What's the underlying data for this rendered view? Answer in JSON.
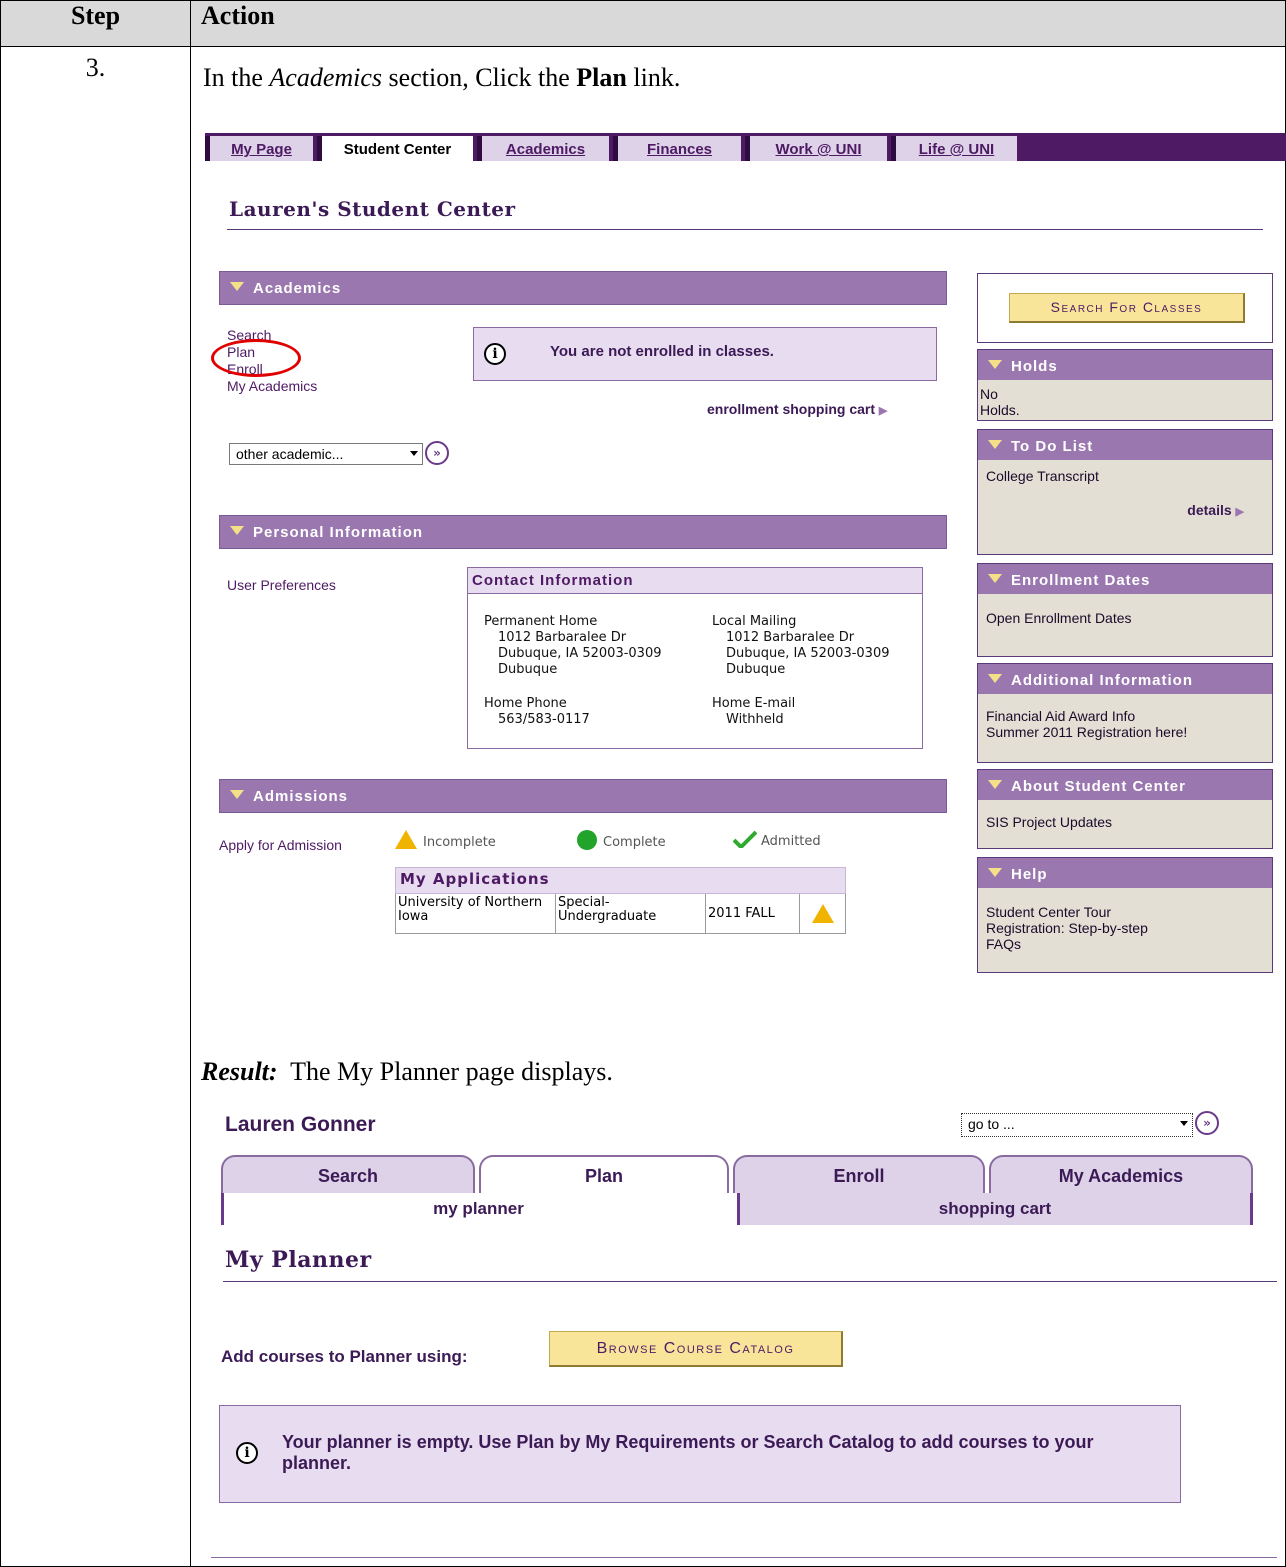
{
  "table": {
    "header_step": "Step",
    "header_action": "Action",
    "step_number": "3."
  },
  "instruction": {
    "prefix": "In the ",
    "section": "Academics",
    "middle": " section, Click the ",
    "link": "Plan",
    "suffix": " link."
  },
  "result": {
    "label": "Result:",
    "text": "  The My Planner page displays."
  },
  "student_center": {
    "tabs": [
      "My Page",
      "Student Center",
      "Academics",
      "Finances",
      "Work @ UNI",
      "Life @ UNI"
    ],
    "title": "Lauren's Student Center",
    "academics": {
      "heading": "Academics",
      "links": [
        "Search",
        "Plan",
        "Enroll",
        "My Academics"
      ],
      "notice": "You are not enrolled in classes.",
      "cart_link": "enrollment shopping cart",
      "dropdown_value": "other academic..."
    },
    "personal": {
      "heading": "Personal Information",
      "user_prefs": "User Preferences",
      "contact_heading": "Contact Information",
      "perm_label": "Permanent Home",
      "perm_line1": "1012 Barbaralee Dr",
      "perm_line2": "Dubuque, IA 52003-0309",
      "perm_line3": "Dubuque",
      "local_label": "Local Mailing",
      "local_line1": "1012 Barbaralee Dr",
      "local_line2": "Dubuque, IA 52003-0309",
      "local_line3": "Dubuque",
      "phone_label": "Home Phone",
      "phone_value": "563/583-0117",
      "email_label": "Home E-mail",
      "email_value": "Withheld"
    },
    "admissions": {
      "heading": "Admissions",
      "apply_link": "Apply for Admission",
      "legend_incomplete": "Incomplete",
      "legend_complete": "Complete",
      "legend_admitted": "Admitted",
      "apps_heading": "My Applications",
      "app_institution": "University of Northern Iowa",
      "app_program": "Special-Undergraduate",
      "app_term": "2011 FALL"
    },
    "sidebar": {
      "search_button": "Search For Classes",
      "holds_heading": "Holds",
      "holds_text": "No Holds.",
      "todo_heading": "To Do List",
      "todo_item": "College Transcript",
      "todo_details": "details",
      "enroll_heading": "Enrollment Dates",
      "enroll_link": "Open Enrollment Dates",
      "addl_heading": "Additional Information",
      "addl_link1": "Financial Aid Award Info",
      "addl_link2": "Summer 2011 Registration here!",
      "about_heading": "About Student Center",
      "about_link": "SIS Project Updates",
      "help_heading": "Help",
      "help_link1": "Student Center Tour",
      "help_link2": "Registration: Step-by-step",
      "help_link3": "FAQs"
    }
  },
  "planner": {
    "student_name": "Lauren Gonner",
    "goto_value": "go to ...",
    "tabs": [
      "Search",
      "Plan",
      "Enroll",
      "My Academics"
    ],
    "subtabs": [
      "my planner",
      "shopping cart"
    ],
    "title": "My Planner",
    "add_label": "Add courses to Planner using:",
    "browse_button": "Browse Course Catalog",
    "empty_message": "Your planner is empty.  Use Plan by My Requirements or Search Catalog to add courses to your planner."
  },
  "colors": {
    "brand_purple": "#4e1a64",
    "section_header": "#9b77b0",
    "gold_button": "#f8e59a",
    "highlight_red": "#e00000"
  }
}
